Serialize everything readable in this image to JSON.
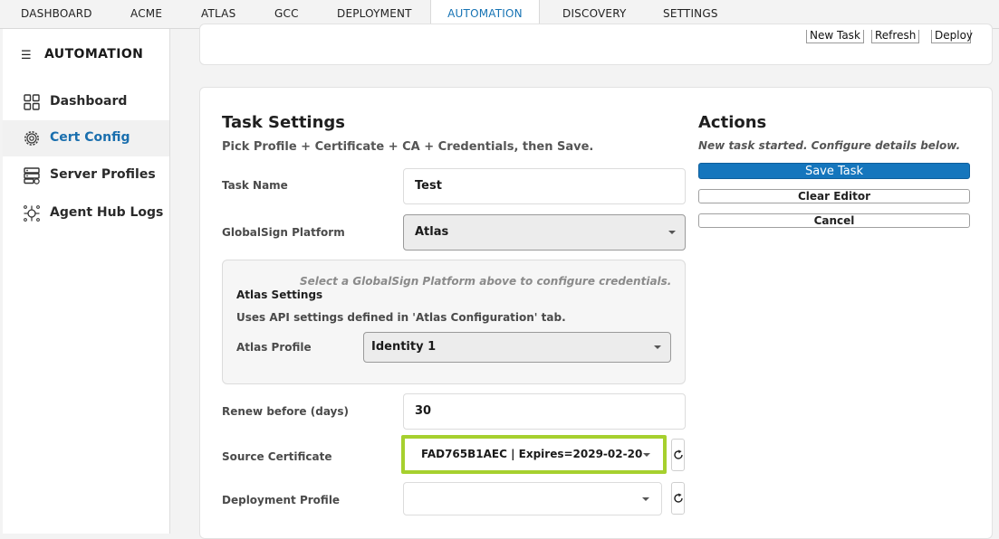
{
  "topnav": {
    "tabs": [
      "DASHBOARD",
      "ACME",
      "ATLAS",
      "GCC",
      "DEPLOYMENT",
      "AUTOMATION",
      "DISCOVERY",
      "SETTINGS"
    ],
    "active_tab": "AUTOMATION"
  },
  "sidebar": {
    "title": "AUTOMATION",
    "items": [
      {
        "label": "Dashboard",
        "icon": "grid-icon"
      },
      {
        "label": "Cert Config",
        "icon": "gear-icon"
      },
      {
        "label": "Server Profiles",
        "icon": "server-icon"
      },
      {
        "label": "Agent Hub Logs",
        "icon": "api-hub-icon"
      }
    ],
    "active_item": "Cert Config"
  },
  "toolbar": {
    "new_task": "New Task",
    "refresh": "Refresh",
    "deploy": "Deploy"
  },
  "task_settings": {
    "title": "Task Settings",
    "subtitle": "Pick Profile + Certificate + CA + Credentials, then Save.",
    "task_name_label": "Task Name",
    "task_name_value": "Test",
    "platform_label": "GlobalSign Platform",
    "platform_value": "Atlas",
    "platform_hint": "Select a GlobalSign Platform above to configure credentials.",
    "atlas_settings_title": "Atlas Settings",
    "atlas_settings_desc": "Uses API settings defined in 'Atlas Configuration' tab.",
    "atlas_profile_label": "Atlas Profile",
    "atlas_profile_value": "Identity 1",
    "renew_label": "Renew before (days)",
    "renew_value": "30",
    "source_cert_label": "Source Certificate",
    "source_cert_value": "FAD765B1AEC | Expires=2029-02-20",
    "deployment_profile_label": "Deployment Profile",
    "deployment_profile_value": ""
  },
  "actions": {
    "title": "Actions",
    "status": "New task started. Configure details below.",
    "save": "Save Task",
    "clear": "Clear Editor",
    "cancel": "Cancel"
  },
  "colors": {
    "accent": "#1576bd",
    "highlight": "#a6d02e"
  }
}
